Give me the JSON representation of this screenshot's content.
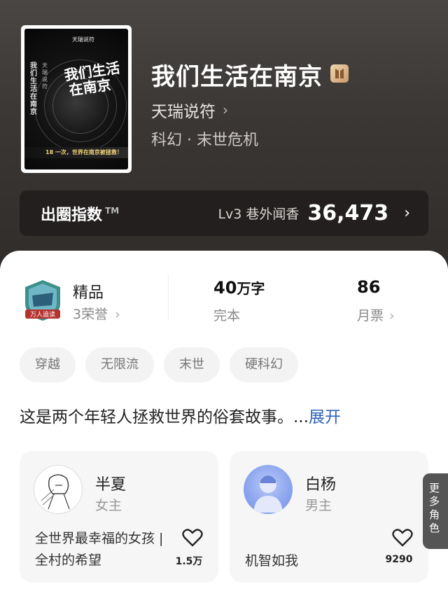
{
  "book": {
    "title": "我们生活在南京",
    "author": "天瑞说符",
    "genre": "科幻 · 末世危机",
    "cover": {
      "title_line1": "我们生活",
      "title_line2": "在南京",
      "spine_a": "我们生活在南京",
      "spine_b": "天瑞说符",
      "author": "天瑞说符",
      "band_text": "18 一次，世界在南京被拯救！"
    }
  },
  "index_bar": {
    "label": "出圈指数",
    "tm": "TM",
    "level": "Lv3 巷外闻香",
    "value": "36,473"
  },
  "stats": {
    "honor_title": "精品",
    "honor_sub": "3荣誉",
    "honor_emblem_text": "万人追读",
    "words_value": "40",
    "words_unit": "万字",
    "words_status": "完本",
    "ticket_value": "86",
    "ticket_label": "月票"
  },
  "tags": [
    "穿越",
    "无限流",
    "末世",
    "硬科幻"
  ],
  "synopsis": {
    "text": "这是两个年轻人拯救世界的俗套故事。...",
    "expand": "展开"
  },
  "roles": [
    {
      "name": "半夏",
      "type": "女主",
      "desc": "全世界最幸福的女孩 | 全村的希望",
      "likes": "1.5万"
    },
    {
      "name": "白杨",
      "type": "男主",
      "desc": "机智如我",
      "likes": "9290"
    }
  ],
  "more_roles": "更多角色",
  "colors": {
    "hero_bg": "#3a3634",
    "link": "#2f63b8",
    "index_bar_bg": "#221f1e"
  },
  "icons": [
    "chevron-right-icon",
    "heart-outline-icon",
    "honor-emblem-icon",
    "title-badge-icon"
  ]
}
